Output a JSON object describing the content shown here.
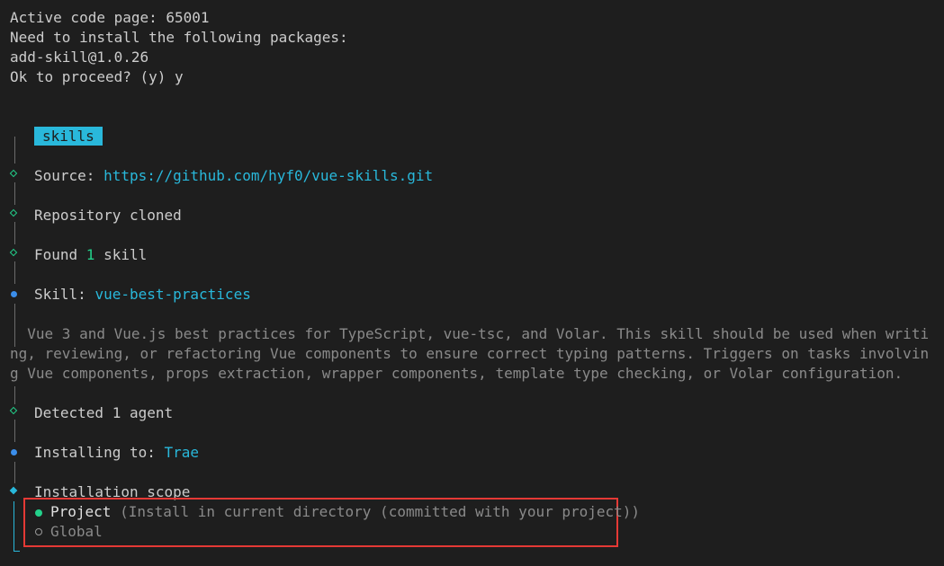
{
  "preamble": {
    "line1": "Active code page: 65001",
    "line2": "Need to install the following packages:",
    "line3": "add-skill@1.0.26",
    "line4": "Ok to proceed? (y) y"
  },
  "badge": {
    "label": "skills",
    "color": "#29b8db"
  },
  "steps": {
    "source_label": "Source: ",
    "source_url": "https://github.com/hyf0/vue-skills.git",
    "cloned": "Repository cloned",
    "found_prefix": "Found ",
    "found_count": "1",
    "found_suffix": " skill",
    "skill_label": "Skill: ",
    "skill_name": "vue-best-practices",
    "description": "  Vue 3 and Vue.js best practices for TypeScript, vue-tsc, and Volar. This skill should be used when writing, reviewing, or refactoring Vue components to ensure correct typing patterns. Triggers on tasks involving Vue components, props extraction, wrapper components, template type checking, or Volar configuration.",
    "detected": "Detected 1 agent",
    "installing_label": "Installing to: ",
    "installing_target": "Trae",
    "scope_question": "Installation scope"
  },
  "scope_options": [
    {
      "label": "Project",
      "hint": " (Install in current directory (committed with your project))",
      "selected": true
    },
    {
      "label": "Global",
      "hint": "",
      "selected": false
    }
  ],
  "colors": {
    "accent": "#29b8db",
    "success": "#23d18b",
    "active_dot": "#3b8eea",
    "selection_border": "#e53935"
  }
}
